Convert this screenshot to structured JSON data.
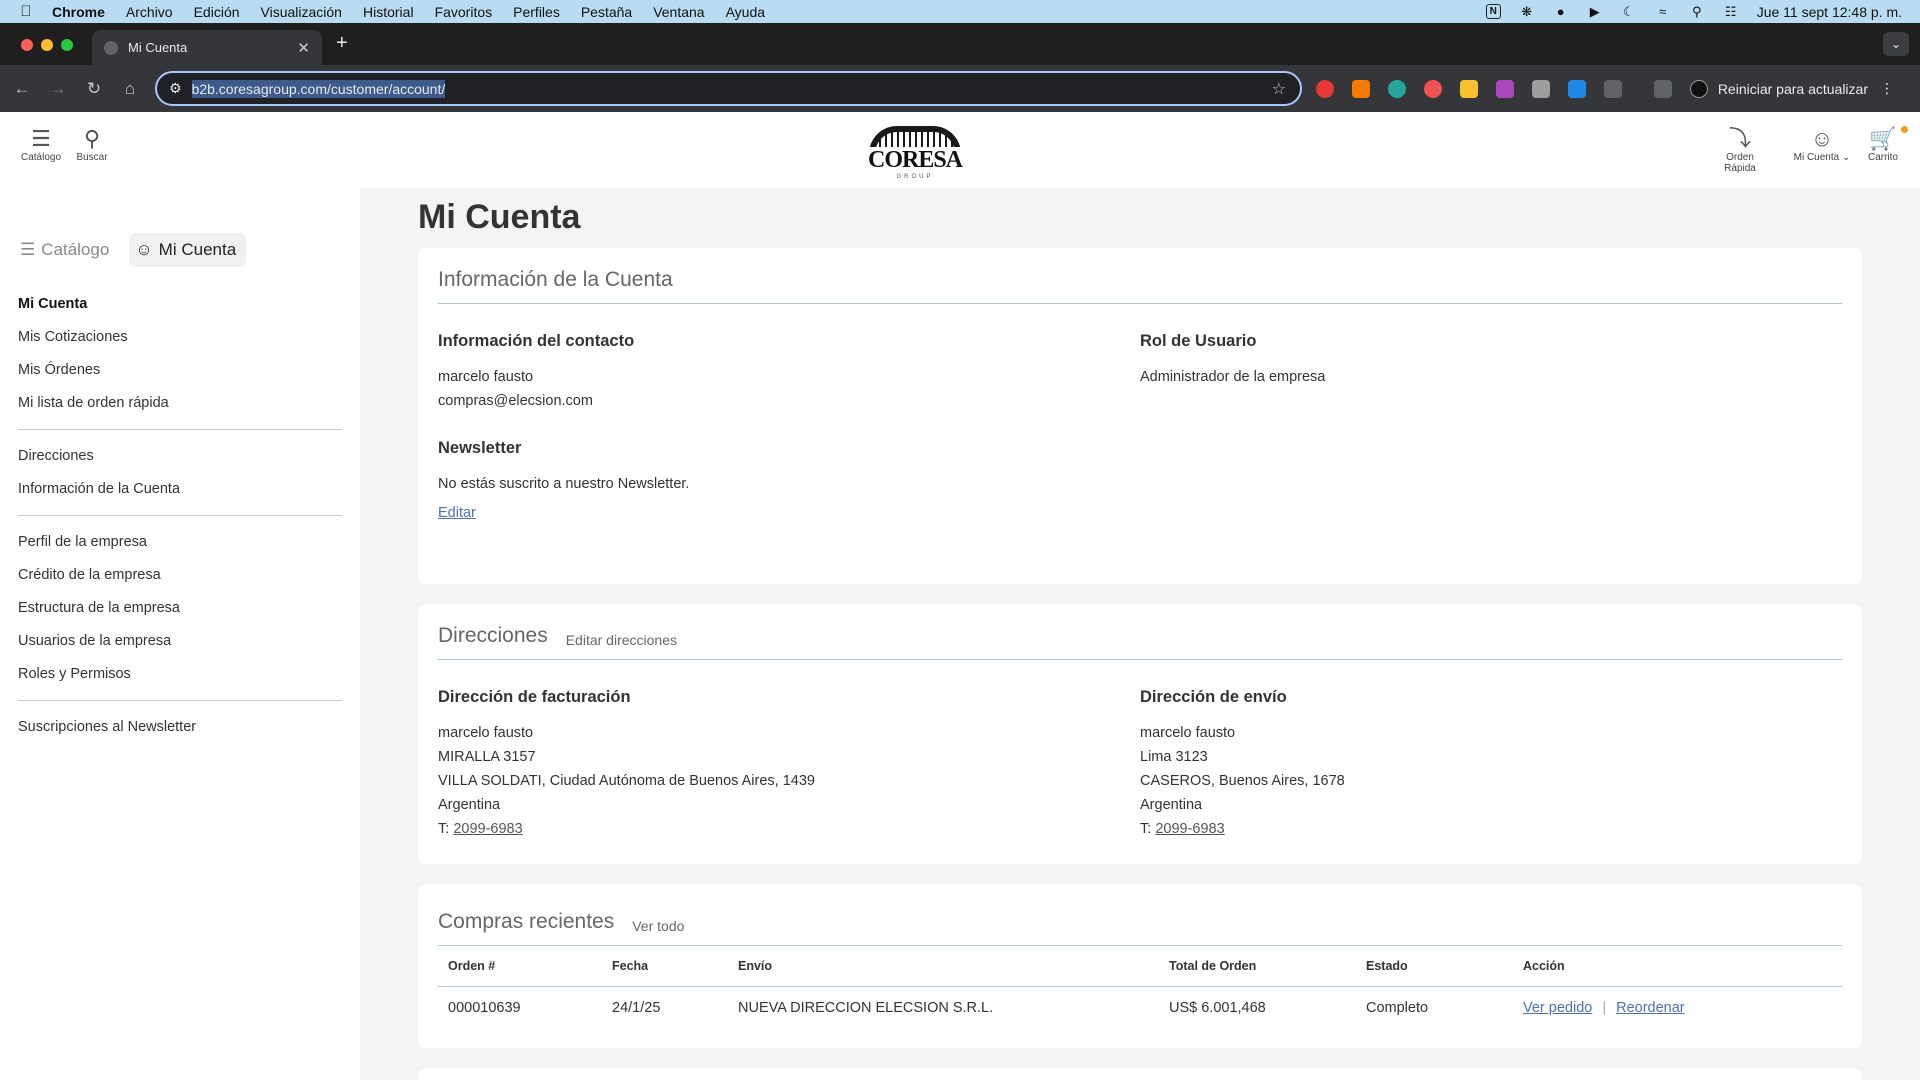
{
  "menubar": {
    "app": "Chrome",
    "items": [
      "Archivo",
      "Edición",
      "Visualización",
      "Historial",
      "Favoritos",
      "Perfiles",
      "Pestaña",
      "Ventana",
      "Ayuda"
    ],
    "datetime": "Jue 11 sept  12:48 p. m."
  },
  "browser": {
    "tab_title": "Mi Cuenta",
    "url": "b2b.coresagroup.com/customer/account/",
    "update_label": "Reiniciar para actualizar"
  },
  "header": {
    "catalog_label": "Catálogo",
    "search_label": "Buscar",
    "logo_word": "CORESA",
    "logo_group": "GROUP",
    "quick_order_label": "Orden Rápida",
    "account_label": "Mi Cuenta",
    "cart_label": "Carrito"
  },
  "sidebar": {
    "tab_catalog": "Catálogo",
    "tab_account": "Mi Cuenta",
    "group1": [
      "Mi Cuenta",
      "Mis Cotizaciones",
      "Mis Órdenes",
      "Mi lista de orden rápida"
    ],
    "group2": [
      "Direcciones",
      "Información de la Cuenta"
    ],
    "group3": [
      "Perfil de la empresa",
      "Crédito de la empresa",
      "Estructura de la empresa",
      "Usuarios de la empresa",
      "Roles y Permisos"
    ],
    "group4": [
      "Suscripciones al Newsletter"
    ]
  },
  "main": {
    "title": "Mi Cuenta",
    "account_info": {
      "heading": "Información de la Cuenta",
      "contact_title": "Información del contacto",
      "contact_name": "marcelo fausto",
      "contact_email": "compras@elecsion.com",
      "role_title": "Rol de Usuario",
      "role_value": "Administrador de la empresa",
      "newsletter_title": "Newsletter",
      "newsletter_text": "No estás suscrito a nuestro Newsletter.",
      "edit_label": "Editar"
    },
    "addresses": {
      "heading": "Direcciones",
      "edit_label": "Editar direcciones",
      "billing": {
        "title": "Dirección de facturación",
        "name": "marcelo fausto",
        "street": "MIRALLA 3157",
        "city": "VILLA SOLDATI, Ciudad Autónoma de Buenos Aires, 1439",
        "country": "Argentina",
        "phone_prefix": "T: ",
        "phone": "2099-6983"
      },
      "shipping": {
        "title": "Dirección de envío",
        "name": "marcelo fausto",
        "street": "Lima 3123",
        "city": "CASEROS, Buenos Aires, 1678",
        "country": "Argentina",
        "phone_prefix": "T: ",
        "phone": "2099-6983"
      }
    },
    "orders": {
      "heading": "Compras recientes",
      "view_all": "Ver todo",
      "columns": [
        "Orden #",
        "Fecha",
        "Envío",
        "Total de Orden",
        "Estado",
        "Acción"
      ],
      "rows": [
        {
          "order": "000010639",
          "date": "24/1/25",
          "ship_to": "NUEVA DIRECCION ELECSION S.R.L.",
          "total": "US$ 6.001,468",
          "status": "Completo",
          "view_label": "Ver pedido",
          "reorder_label": "Reordenar"
        }
      ]
    }
  }
}
